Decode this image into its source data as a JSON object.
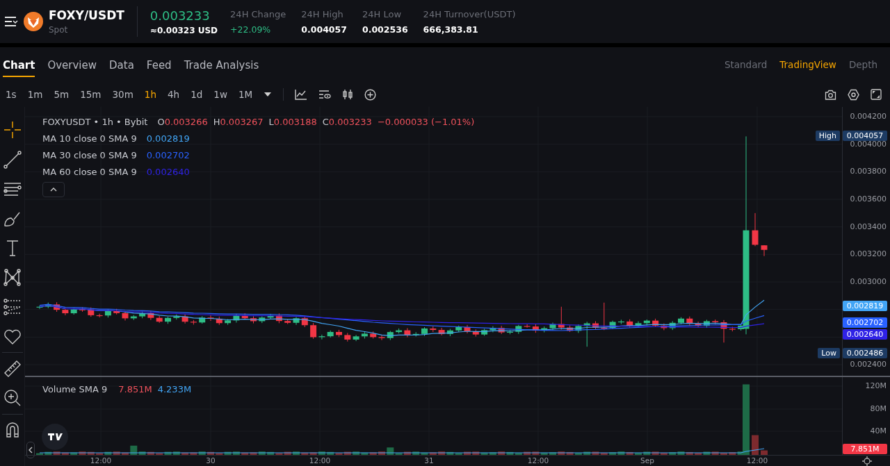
{
  "header": {
    "pair": "FOXY/USDT",
    "market": "Spot",
    "price": "0.003233",
    "price_usd": "≈0.00323 USD",
    "stats": [
      {
        "label": "24H Change",
        "value": "+22.09%",
        "kind": "up"
      },
      {
        "label": "24H High",
        "value": "0.004057",
        "kind": "plain"
      },
      {
        "label": "24H Low",
        "value": "0.002536",
        "kind": "plain"
      },
      {
        "label": "24H Turnover(USDT)",
        "value": "666,383.81",
        "kind": "plain"
      }
    ]
  },
  "tabs": [
    {
      "label": "Chart",
      "selected": true
    },
    {
      "label": "Overview",
      "selected": false
    },
    {
      "label": "Data",
      "selected": false
    },
    {
      "label": "Feed",
      "selected": false
    },
    {
      "label": "Trade Analysis",
      "selected": false
    }
  ],
  "views": [
    {
      "label": "Standard",
      "selected": false
    },
    {
      "label": "TradingView",
      "selected": true
    },
    {
      "label": "Depth",
      "selected": false
    }
  ],
  "timeframes": [
    {
      "label": "1s",
      "selected": false
    },
    {
      "label": "1m",
      "selected": false
    },
    {
      "label": "5m",
      "selected": false
    },
    {
      "label": "15m",
      "selected": false
    },
    {
      "label": "30m",
      "selected": false
    },
    {
      "label": "1h",
      "selected": true
    },
    {
      "label": "4h",
      "selected": false
    },
    {
      "label": "1d",
      "selected": false
    },
    {
      "label": "1w",
      "selected": false
    },
    {
      "label": "1M",
      "selected": false
    }
  ],
  "tools": [
    {
      "kind": "crosshair",
      "selected": true
    },
    {
      "kind": "trend-line",
      "selected": false
    },
    {
      "kind": "horizontal-lines",
      "selected": false
    },
    {
      "kind": "brush",
      "selected": false
    },
    {
      "kind": "text",
      "selected": false
    },
    {
      "kind": "pattern",
      "selected": false
    },
    {
      "kind": "fib",
      "selected": false
    },
    {
      "kind": "heart",
      "selected": false
    },
    {
      "kind": "ruler",
      "selected": false
    },
    {
      "kind": "zoom",
      "selected": false
    },
    {
      "kind": "magnet",
      "selected": false
    }
  ],
  "legend": {
    "symbol": "FOXYUSDT • 1h • Bybit",
    "ohlc": [
      {
        "key": "O",
        "value": "0.003266"
      },
      {
        "key": "H",
        "value": "0.003267"
      },
      {
        "key": "L",
        "value": "0.003188"
      },
      {
        "key": "C",
        "value": "0.003233"
      }
    ],
    "change": "−0.000033 (−1.01%)",
    "mas": [
      {
        "label": "MA 10 close 0 SMA 9",
        "value": "0.002819",
        "color": "#42a5f5"
      },
      {
        "label": "MA 30 close 0 SMA 9",
        "value": "0.002702",
        "color": "#2962ff"
      },
      {
        "label": "MA 60 close 0 SMA 9",
        "value": "0.002640",
        "color": "#2f22e6"
      }
    ]
  },
  "price_axis": {
    "ticks": [
      "0.004200",
      "0.004000",
      "0.003800",
      "0.003600",
      "0.003400",
      "0.003200",
      "0.003000",
      "0.002400"
    ],
    "tags": [
      {
        "label": "High",
        "value": "0.004057",
        "color": "#1d3b63"
      },
      {
        "value": "0.002819",
        "color": "#42a5f5"
      },
      {
        "value": "0.002702",
        "color": "#2962ff"
      },
      {
        "value": "0.002640",
        "color": "#2f22e6"
      },
      {
        "label": "Low",
        "value": "0.002486",
        "color": "#1d3b63"
      }
    ]
  },
  "volume": {
    "label": "Volume SMA 9",
    "values": [
      {
        "value": "7.851M",
        "color": "#f0525c"
      },
      {
        "value": "4.233M",
        "color": "#42a5f5"
      }
    ],
    "ticks": [
      "120M",
      "80M",
      "40M"
    ],
    "tag": "7.851M"
  },
  "time_axis": [
    "12:00",
    "30",
    "12:00",
    "31",
    "12:00",
    "Sep",
    "12:00"
  ]
}
